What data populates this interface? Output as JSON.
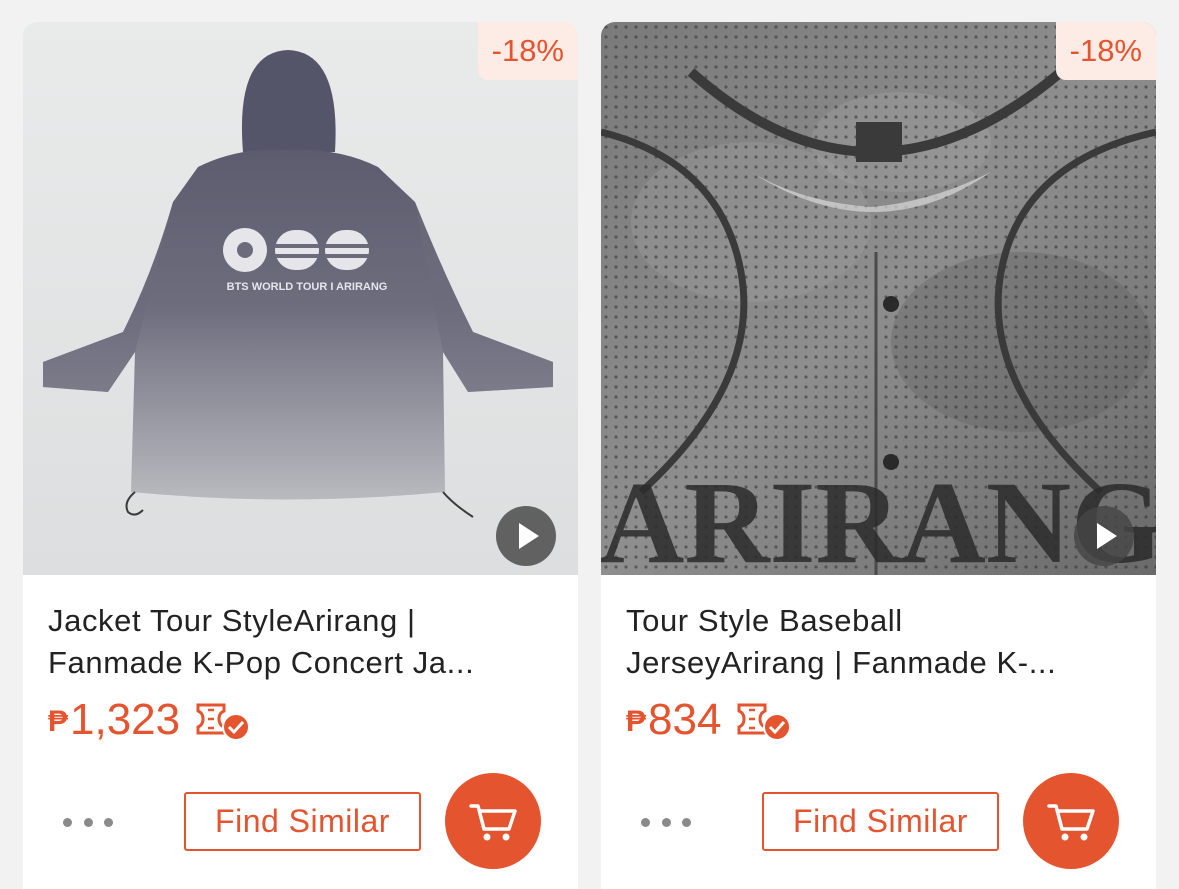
{
  "products": [
    {
      "discount": "-18%",
      "title_line1": "Jacket Tour StyleArirang |",
      "title_line2": "Fanmade K-Pop Concert Ja...",
      "currency": "₱",
      "price": "1,323",
      "graphic_text": "BTS WORLD TOUR I ARIRANG",
      "find_similar_label": "Find Similar",
      "has_video": true
    },
    {
      "discount": "-18%",
      "title_line1": "Tour Style Baseball",
      "title_line2": "JerseyArirang | Fanmade K-...",
      "currency": "₱",
      "price": "834",
      "graphic_text": "ARIRANG",
      "find_similar_label": "Find Similar",
      "has_video": true
    }
  ],
  "icons": {
    "play": "play-icon",
    "voucher": "voucher-check-icon",
    "more": "more-dots-icon",
    "cart": "cart-icon"
  },
  "colors": {
    "accent": "#e4542f",
    "discount_bg": "#fdebe6",
    "background": "#f2f2f2"
  }
}
